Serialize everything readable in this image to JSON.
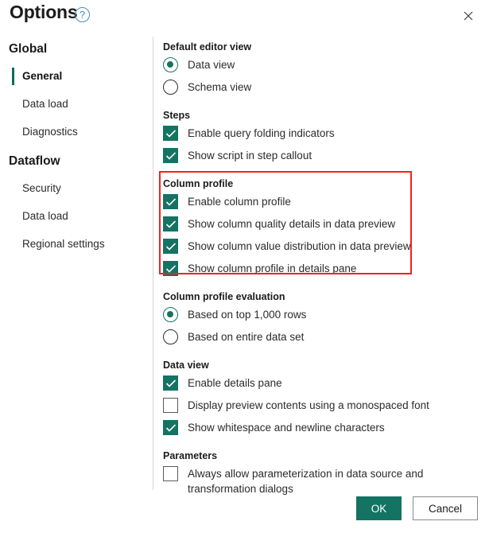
{
  "header": {
    "title": "Options",
    "help_icon": "help-circle-icon",
    "close_icon": "close-icon"
  },
  "sidebar": {
    "groups": [
      {
        "title": "Global",
        "items": [
          {
            "label": "General",
            "selected": true
          },
          {
            "label": "Data load",
            "selected": false
          },
          {
            "label": "Diagnostics",
            "selected": false
          }
        ]
      },
      {
        "title": "Dataflow",
        "items": [
          {
            "label": "Security",
            "selected": false
          },
          {
            "label": "Data load",
            "selected": false
          },
          {
            "label": "Regional settings",
            "selected": false
          }
        ]
      }
    ]
  },
  "content": {
    "sections": [
      {
        "label": "Default editor view",
        "type": "radio",
        "options": [
          {
            "label": "Data view",
            "selected": true
          },
          {
            "label": "Schema view",
            "selected": false
          }
        ]
      },
      {
        "label": "Steps",
        "type": "checkbox",
        "options": [
          {
            "label": "Enable query folding indicators",
            "checked": true
          },
          {
            "label": "Show script in step callout",
            "checked": true
          }
        ]
      },
      {
        "label": "Column profile",
        "type": "checkbox",
        "highlighted": true,
        "options": [
          {
            "label": "Enable column profile",
            "checked": true
          },
          {
            "label": "Show column quality details in data preview",
            "checked": true
          },
          {
            "label": "Show column value distribution in data preview",
            "checked": true
          },
          {
            "label": "Show column profile in details pane",
            "checked": true
          }
        ]
      },
      {
        "label": "Column profile evaluation",
        "type": "radio",
        "options": [
          {
            "label": "Based on top 1,000 rows",
            "selected": true
          },
          {
            "label": "Based on entire data set",
            "selected": false
          }
        ]
      },
      {
        "label": "Data view",
        "type": "checkbox",
        "options": [
          {
            "label": "Enable details pane",
            "checked": true
          },
          {
            "label": "Display preview contents using a monospaced font",
            "checked": false
          },
          {
            "label": "Show whitespace and newline characters",
            "checked": true
          }
        ]
      },
      {
        "label": "Parameters",
        "type": "checkbox",
        "options": [
          {
            "label": "Always allow parameterization in data source and transformation dialogs",
            "checked": false
          }
        ]
      }
    ]
  },
  "footer": {
    "ok_label": "OK",
    "cancel_label": "Cancel"
  },
  "colors": {
    "accent": "#147362",
    "selected_bar": "#0e6b5a",
    "highlight": "#f42121",
    "help_icon": "#3b8fd4"
  }
}
